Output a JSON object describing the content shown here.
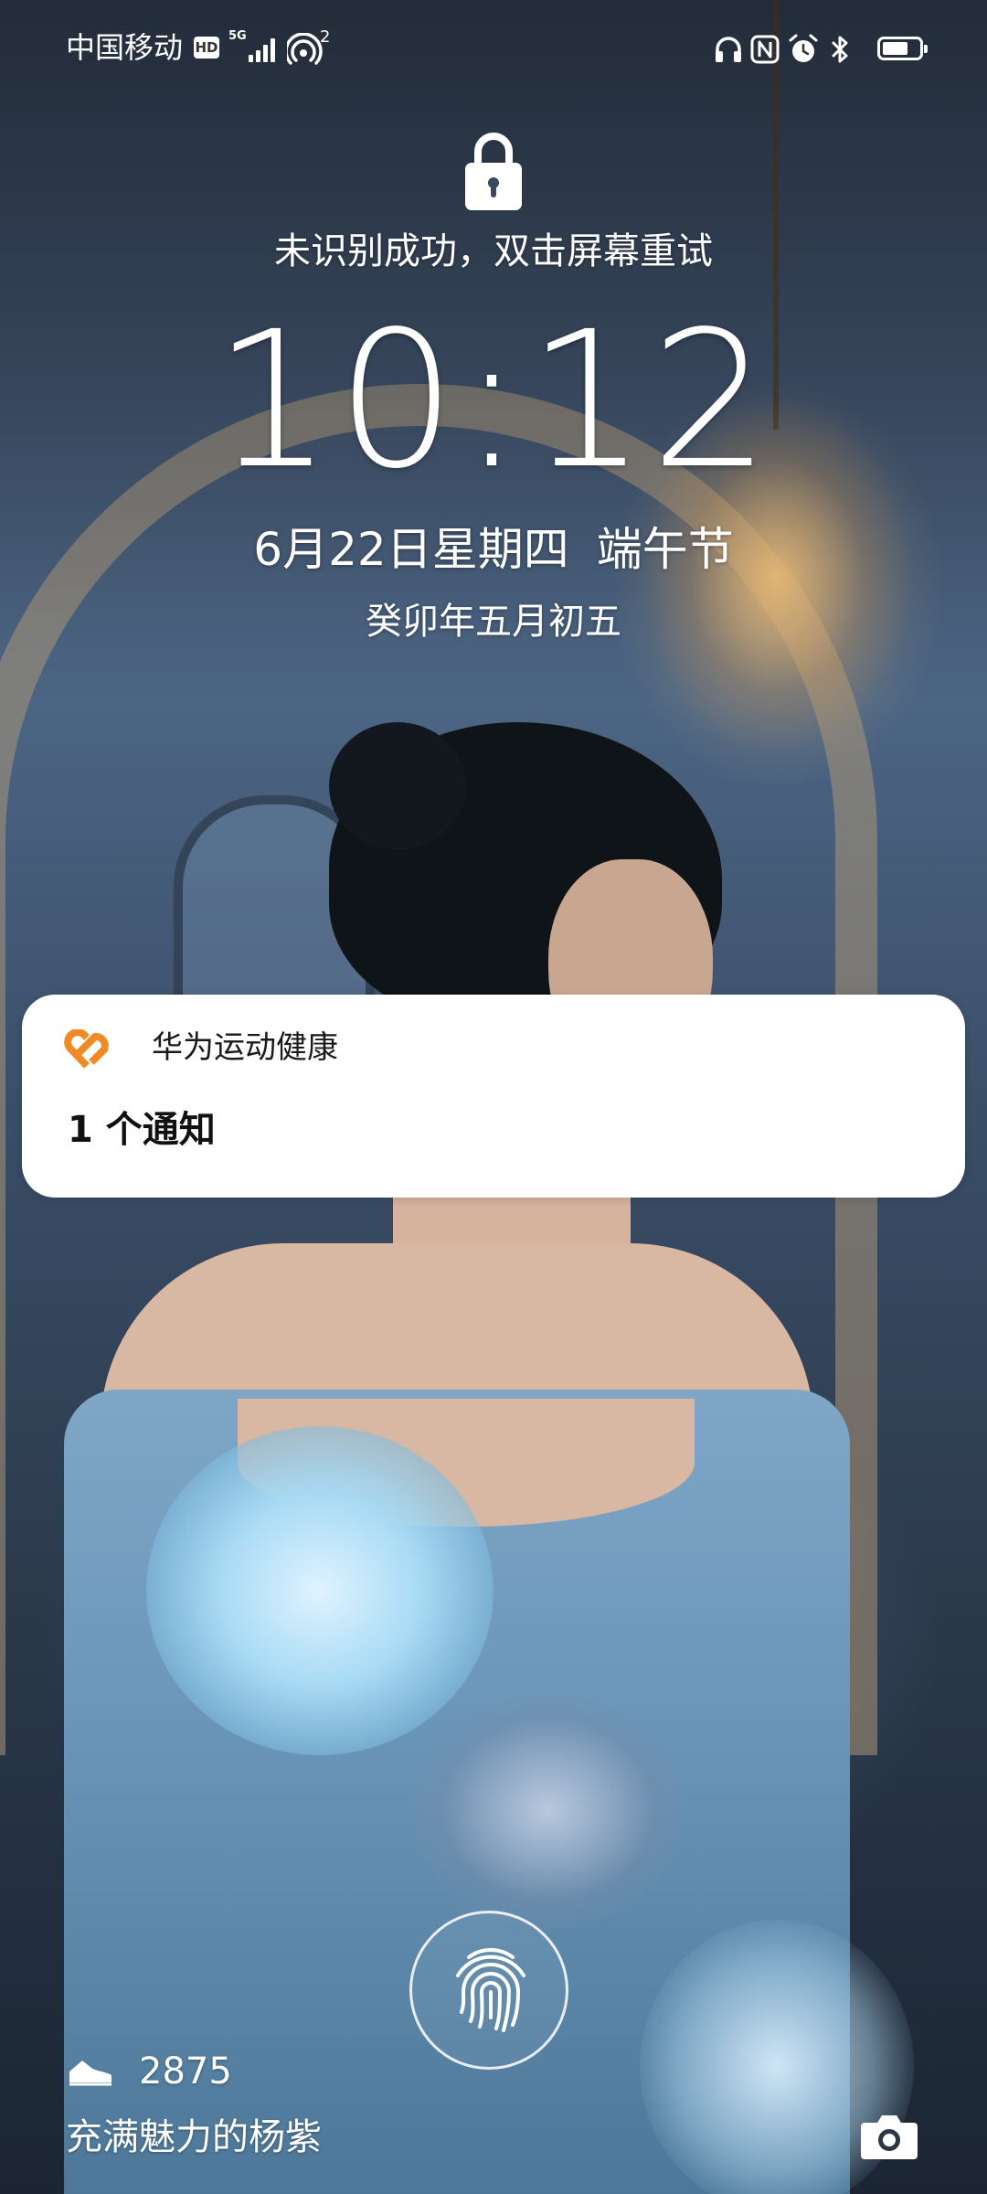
{
  "status_bar": {
    "carrier": "中国移动",
    "hd_badge": "HD",
    "network_type": "5G",
    "hotspot_connections": "2",
    "icons": [
      "hd-icon",
      "signal-icon",
      "hotspot-icon",
      "headphones-icon",
      "nfc-icon",
      "alarm-icon",
      "bluetooth-icon",
      "battery-icon"
    ],
    "battery_level": 0.7
  },
  "lock_screen": {
    "lock_icon": "lock-icon",
    "unlock_hint": "未识别成功，双击屏幕重试",
    "time": "10:12",
    "date": "6月22日星期四",
    "festival": "端午节",
    "lunar_date": "癸卯年五月初五"
  },
  "notification": {
    "app_icon": "huawei-health-icon",
    "app_icon_color": "#F08A24",
    "app_name": "华为运动健康",
    "text": "1 个通知"
  },
  "bottom": {
    "steps_icon": "shoe-icon",
    "steps": "2875",
    "signature": "充满魅力的杨紫",
    "fingerprint_icon": "fingerprint-icon",
    "camera_icon": "camera-icon"
  }
}
